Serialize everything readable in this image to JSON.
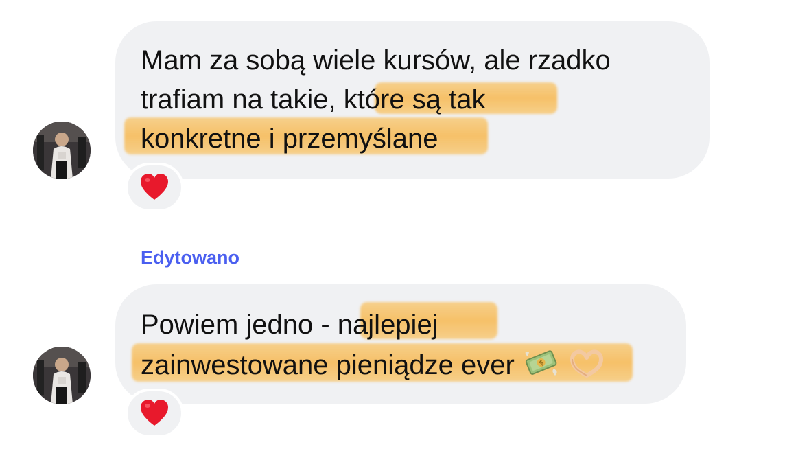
{
  "messages": [
    {
      "lines": [
        "Mam za sobą wiele kursów, ale rzadko",
        "trafiam na takie, ",
        "które są tak",
        "konkretne i przemyślane"
      ],
      "reaction": "heart"
    },
    {
      "edited_label": "Edytowano",
      "lines": [
        "Powiem jedno - ",
        "najlepiej",
        "zainwestowane pieniądze ever"
      ],
      "reaction": "heart",
      "trailing_icons": [
        "money-with-wings-icon",
        "heart-hands-icon"
      ]
    }
  ],
  "colors": {
    "bubble": "#f0f1f3",
    "highlight": "#f6bc5c",
    "edited": "#4a5ff0",
    "heart": "#e8192c"
  }
}
